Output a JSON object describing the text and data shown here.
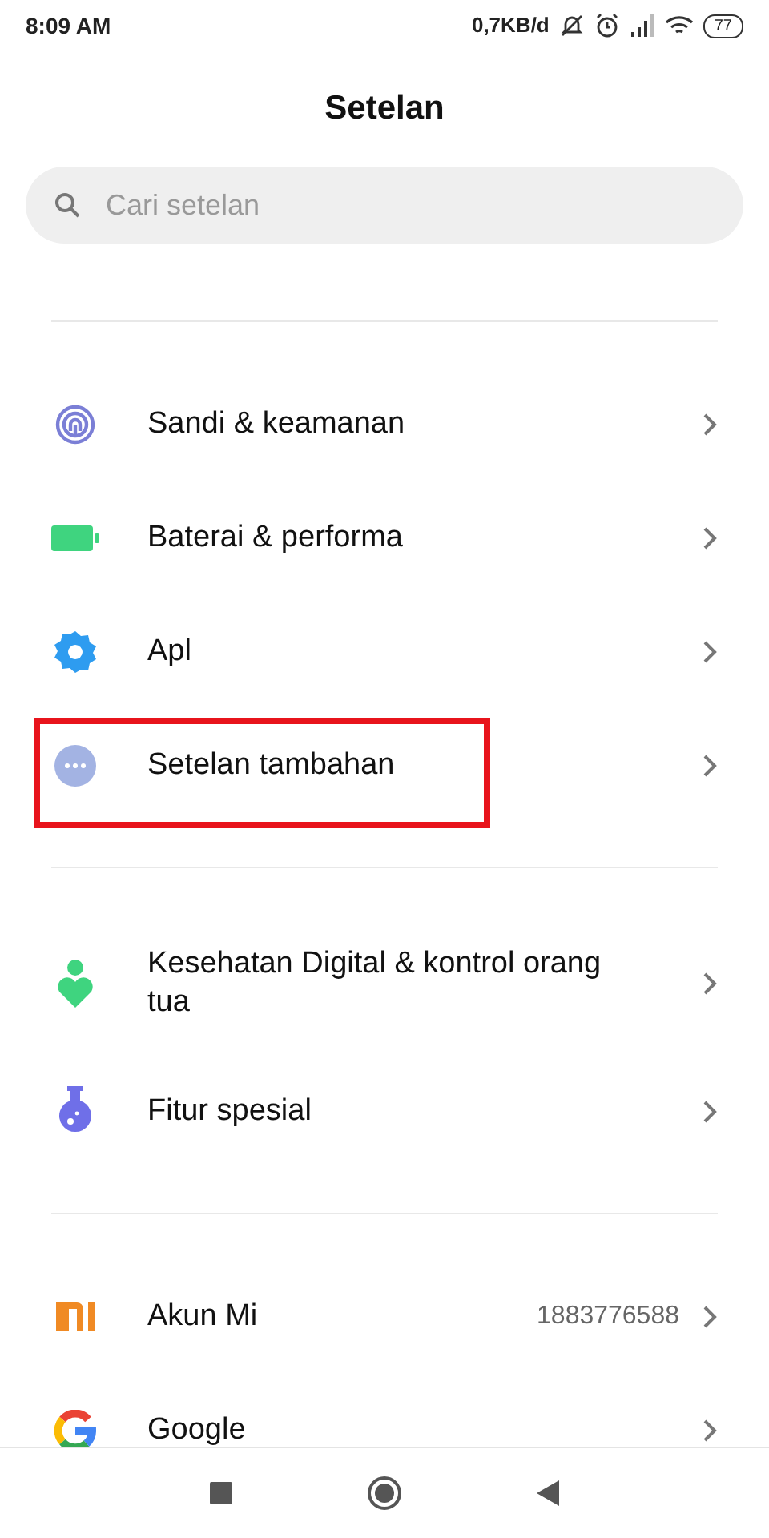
{
  "status_bar": {
    "time": "8:09 AM",
    "speed": "0,7KB/d",
    "battery": "77"
  },
  "title": "Setelan",
  "search": {
    "placeholder": "Cari setelan"
  },
  "groups": [
    {
      "items": [
        {
          "kind": "fingerprint",
          "label": "Sandi & keamanan",
          "highlighted": false
        },
        {
          "kind": "battery",
          "label": "Baterai & performa",
          "highlighted": false
        },
        {
          "kind": "gear",
          "label": "Apl",
          "highlighted": false
        },
        {
          "kind": "dots",
          "label": "Setelan tambahan",
          "highlighted": true
        }
      ]
    },
    {
      "items": [
        {
          "kind": "wellbeing",
          "label": "Kesehatan Digital & kontrol orang tua",
          "highlighted": false
        },
        {
          "kind": "flask",
          "label": "Fitur spesial",
          "highlighted": false
        }
      ]
    },
    {
      "items": [
        {
          "kind": "mi",
          "label": "Akun Mi",
          "value": "1883776588",
          "highlighted": false
        },
        {
          "kind": "google",
          "label": "Google",
          "highlighted": false
        }
      ]
    }
  ]
}
